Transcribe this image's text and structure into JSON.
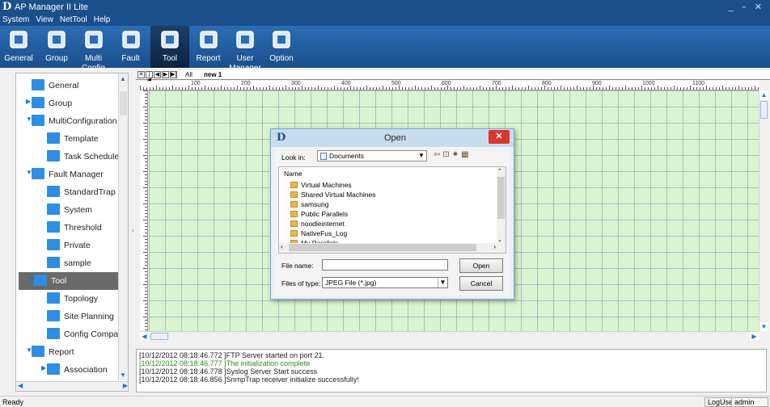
{
  "window": {
    "title": "AP Manager II Lite",
    "logo": "D",
    "controls": "_ ▫ ✕"
  },
  "menu": [
    "System",
    "View",
    "NetTool",
    "Help"
  ],
  "toolbar": [
    {
      "label": "General",
      "icon": "grid-icon"
    },
    {
      "label": "Group",
      "icon": "users-icon"
    },
    {
      "label": "Multi Config",
      "icon": "gear-wifi-icon"
    },
    {
      "label": "Fault",
      "icon": "clipboard-icon"
    },
    {
      "label": "Tool",
      "icon": "tools-icon",
      "active": true
    },
    {
      "label": "Report",
      "icon": "pie-chart-icon"
    },
    {
      "label": "User Manager",
      "icon": "monitor-icon"
    },
    {
      "label": "Option",
      "icon": "cog-icon"
    }
  ],
  "tree": [
    {
      "label": "General",
      "level": 0
    },
    {
      "label": "Group",
      "level": 0,
      "arrow": "▶"
    },
    {
      "label": "MultiConfiguration",
      "level": 0,
      "arrow": "▼"
    },
    {
      "label": "Template",
      "level": 1
    },
    {
      "label": "Task Schedule",
      "level": 1
    },
    {
      "label": "Fault Manager",
      "level": 0,
      "arrow": "▼"
    },
    {
      "label": "StandardTrap",
      "level": 1
    },
    {
      "label": "System",
      "level": 1
    },
    {
      "label": "Threshold",
      "level": 1
    },
    {
      "label": "Private",
      "level": 1
    },
    {
      "label": "sample",
      "level": 1
    },
    {
      "label": "Tool",
      "level": 0,
      "arrow": "▼",
      "selected": true
    },
    {
      "label": "Topology",
      "level": 1
    },
    {
      "label": "Site Planning",
      "level": 1
    },
    {
      "label": "Config Comparis",
      "level": 1
    },
    {
      "label": "Report",
      "level": 0,
      "arrow": "▼"
    },
    {
      "label": "Association",
      "level": 1,
      "arrow": "▶"
    }
  ],
  "tabs": {
    "all": "All",
    "active": "new 1"
  },
  "ruler_labels": [
    "100",
    "200",
    "300",
    "400",
    "500",
    "600",
    "700",
    "800",
    "900",
    "1000",
    "1100"
  ],
  "log": [
    {
      "text": "[10/12/2012 08:18:46.772 ]FTP Server started on port 21.",
      "ok": false
    },
    {
      "text": "[10/12/2012 08:18:46.777 ]The initialization complete",
      "ok": true
    },
    {
      "text": "[10/12/2012 08:18:46.778 ]Syslog Server Start success",
      "ok": false
    },
    {
      "text": "[10/12/2012 08:18:46.856 ]SnmpTrap receiver initialize successfully!",
      "ok": false
    }
  ],
  "status": {
    "left": "Ready",
    "user_type": "LogUser",
    "user": "admin"
  },
  "dialog": {
    "title": "Open",
    "logo": "D",
    "look_in_label": "Look in:",
    "look_in_value": "Documents",
    "column": "Name",
    "files": [
      "Virtual Machines",
      "Shared Virtual Machines",
      "samsung",
      "Public Parallels",
      "noodleinternet",
      "NativeFus_Log",
      "My Parallels"
    ],
    "file_name_label": "File name:",
    "file_name_value": "",
    "file_type_label": "Files of type:",
    "file_type_value": "JPEG File (*.jpg)",
    "open_label": "Open",
    "cancel_label": "Cancel"
  }
}
